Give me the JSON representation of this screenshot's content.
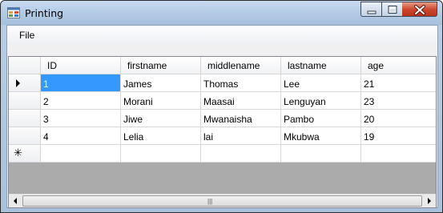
{
  "window": {
    "title": "Printing"
  },
  "menu": {
    "file_label": "File"
  },
  "grid": {
    "columns": [
      "ID",
      "firstname",
      "middlename",
      "lastname",
      "age"
    ],
    "rows": [
      [
        "1",
        "James",
        "Thomas",
        "Lee",
        "21"
      ],
      [
        "2",
        "Morani",
        "Maasai",
        "Lenguyan",
        "23"
      ],
      [
        "3",
        "Jiwe",
        "Mwanaisha",
        "Pambo",
        "20"
      ],
      [
        "4",
        "Lelia",
        "lai",
        "Mkubwa",
        "19"
      ]
    ],
    "new_row_marker": "✳",
    "selected": {
      "row": 0,
      "col": 0
    }
  },
  "scrollbar": {
    "grip": "|||"
  },
  "icons": {
    "app": "app-icon",
    "minimize": "minimize-icon",
    "maximize": "maximize-icon",
    "close": "close-icon",
    "current_row": "current-row-arrow-icon",
    "new_row": "new-row-icon",
    "scroll_left": "scroll-left-icon",
    "scroll_right": "scroll-right-icon"
  },
  "colors": {
    "selection": "#3399ff",
    "grid_background": "#ababab",
    "close_button": "#c8442a"
  }
}
